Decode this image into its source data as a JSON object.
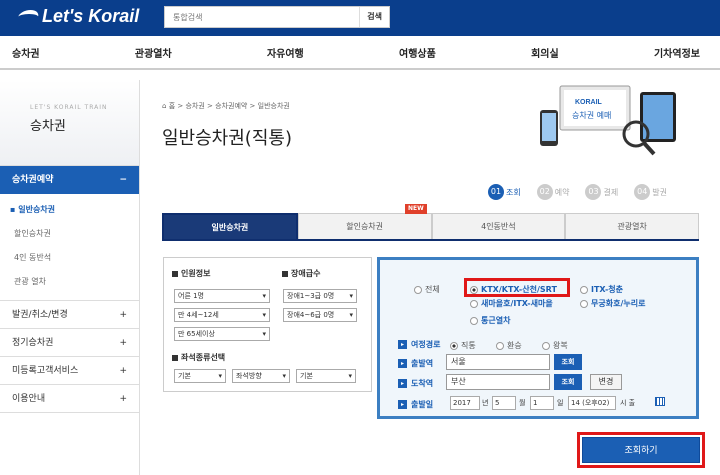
{
  "header": {
    "logo": "Let's Korail",
    "search_placeholder": "통합검색",
    "search_button": "검색"
  },
  "nav": [
    "승차권",
    "관광열차",
    "자유여행",
    "여행상품",
    "회의실",
    "기차역정보"
  ],
  "sidebar": {
    "subtitle": "LET'S KORAIL TRAIN",
    "title": "승차권",
    "active": {
      "label": "승차권예약",
      "toggle": "−"
    },
    "subitems": [
      "일반승차권",
      "할인승차권",
      "4인 동반석",
      "관광 열차"
    ],
    "items": [
      {
        "label": "발권/취소/변경",
        "toggle": "+"
      },
      {
        "label": "정기승차권",
        "toggle": "+"
      },
      {
        "label": "미등록고객서비스",
        "toggle": "+"
      },
      {
        "label": "이용안내",
        "toggle": "+"
      }
    ]
  },
  "breadcrumb": [
    "홈",
    "승차권",
    "승차권예약",
    "일반승차권"
  ],
  "page_title": "일반승차권(직통)",
  "hero": {
    "brand": "KORAIL",
    "text": "승차권 예매"
  },
  "steps": [
    {
      "num": "01",
      "label": "조회"
    },
    {
      "num": "02",
      "label": "예약"
    },
    {
      "num": "03",
      "label": "결제"
    },
    {
      "num": "04",
      "label": "발권"
    }
  ],
  "tabs": [
    "일반승차권",
    "할인승차권",
    "4인동반석",
    "관광열차"
  ],
  "new_badge": "NEW",
  "passenger": {
    "label": "인원정보",
    "adult": "어른 1명",
    "child": "만 4세~12세",
    "senior": "만 65세이상"
  },
  "disabled": {
    "label": "장애급수",
    "grade1": "장애1~3급 0명",
    "grade2": "장애4~6급 0명"
  },
  "seat": {
    "label": "좌석종류선택",
    "type": "기본",
    "direction": "좌석방향",
    "position": "기본"
  },
  "train_types": [
    "전체",
    "KTX/KTX-산천/SRT",
    "ITX-청춘",
    "새마을호/ITX-새마을",
    "무궁화호/누리로",
    "통근열차"
  ],
  "route": {
    "label": "여정경로",
    "options": [
      "직통",
      "환승",
      "왕복"
    ]
  },
  "departure": {
    "label": "출발역",
    "value": "서울",
    "button": "조회"
  },
  "arrival": {
    "label": "도착역",
    "value": "부산",
    "button": "조회",
    "swap": "변경"
  },
  "date": {
    "label": "출발일",
    "year": "2017",
    "year_unit": "년",
    "month": "5",
    "month_unit": "월",
    "day": "1",
    "day_unit": "일",
    "hour": "14 (오후02)",
    "hour_unit": "시 출"
  },
  "submit": "조회하기"
}
